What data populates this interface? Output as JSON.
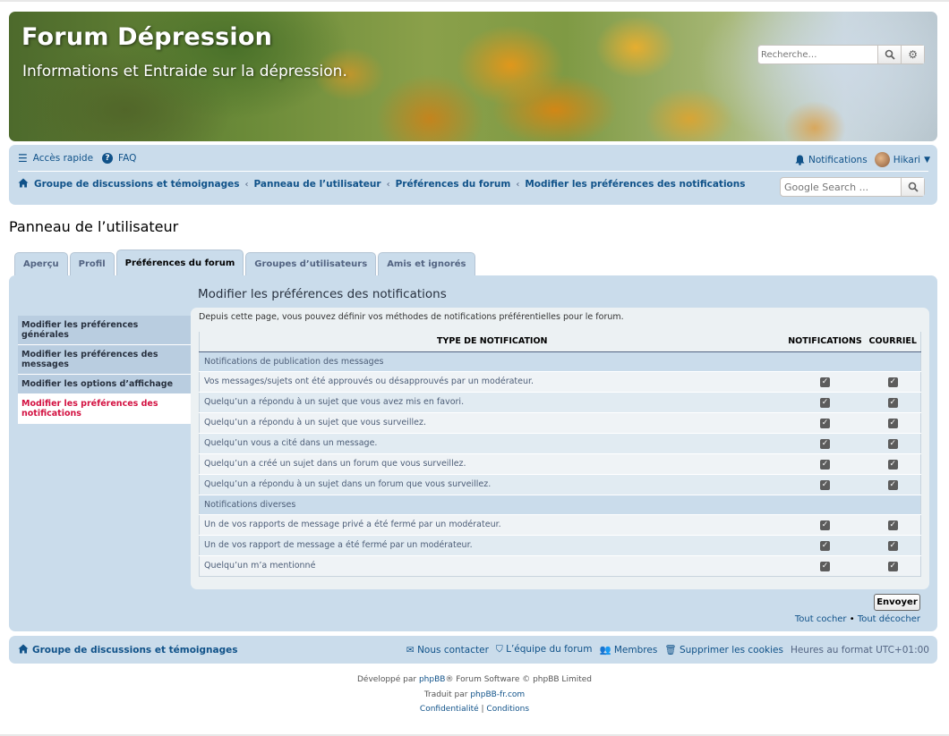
{
  "site": {
    "title": "Forum Dépression",
    "description": "Informations et Entraide sur la dépression.",
    "search_placeholder": "Recherche…"
  },
  "navbar": {
    "quick_access": "Accès rapide",
    "faq": "FAQ",
    "notifications": "Notifications",
    "username": "Hikari",
    "google_search_placeholder": "Google Search ..."
  },
  "breadcrumbs": [
    "Groupe de discussions et témoignages",
    "Panneau de l’utilisateur",
    "Préférences du forum",
    "Modifier les préférences des notifications"
  ],
  "page": {
    "title": "Panneau de l’utilisateur",
    "tabs": [
      "Aperçu",
      "Profil",
      "Préférences du forum",
      "Groupes d’utilisateurs",
      "Amis et ignorés"
    ],
    "active_tab": "Préférences du forum"
  },
  "sidebar": [
    "Modifier les préférences générales",
    "Modifier les préférences des messages",
    "Modifier les options d’affichage",
    "Modifier les préférences des notifications"
  ],
  "content": {
    "heading": "Modifier les préférences des notifications",
    "intro": "Depuis cette page, vous pouvez définir vos méthodes de notifications préférentielles pour le forum.",
    "columns": [
      "TYPE DE NOTIFICATION",
      "NOTIFICATIONS",
      "COURRIEL"
    ],
    "sections": [
      {
        "title": "Notifications de publication des messages",
        "rows": [
          {
            "label": "Vos messages/sujets ont été approuvés ou désapprouvés par un modérateur.",
            "notifications": true,
            "email": true
          },
          {
            "label": "Quelqu’un a répondu à un sujet que vous avez mis en favori.",
            "notifications": true,
            "email": true
          },
          {
            "label": "Quelqu’un a répondu à un sujet que vous surveillez.",
            "notifications": true,
            "email": true
          },
          {
            "label": "Quelqu’un vous a cité dans un message.",
            "notifications": true,
            "email": true
          },
          {
            "label": "Quelqu’un a créé un sujet dans un forum que vous surveillez.",
            "notifications": true,
            "email": true
          },
          {
            "label": "Quelqu’un a répondu à un sujet dans un forum que vous surveillez.",
            "notifications": true,
            "email": true
          }
        ]
      },
      {
        "title": "Notifications diverses",
        "rows": [
          {
            "label": "Un de vos rapports de message privé a été fermé par un modérateur.",
            "notifications": true,
            "email": true
          },
          {
            "label": "Un de vos rapport de message a été fermé par un modérateur.",
            "notifications": true,
            "email": true
          },
          {
            "label": "Quelqu’un m’a mentionné",
            "notifications": true,
            "email": true
          }
        ]
      }
    ],
    "submit": "Envoyer",
    "check_all": "Tout cocher",
    "uncheck_all": "Tout décocher"
  },
  "footer": {
    "home": "Groupe de discussions et témoignages",
    "contact": "Nous contacter",
    "team": "L’équipe du forum",
    "members": "Membres",
    "delete_cookies": "Supprimer les cookies",
    "timezone": "Heures au format UTC+01:00",
    "credit_prefix": "Développé par",
    "phpbb": "phpBB",
    "credit_suffix": "® Forum Software © phpBB Limited",
    "translated_by": "Traduit par",
    "translator": "phpBB-fr.com",
    "privacy": "Confidentialité",
    "terms": "Conditions"
  },
  "colors": {
    "link": "#105289",
    "panel_bg": "#cadceb",
    "active_sidebar": "#d31141"
  }
}
